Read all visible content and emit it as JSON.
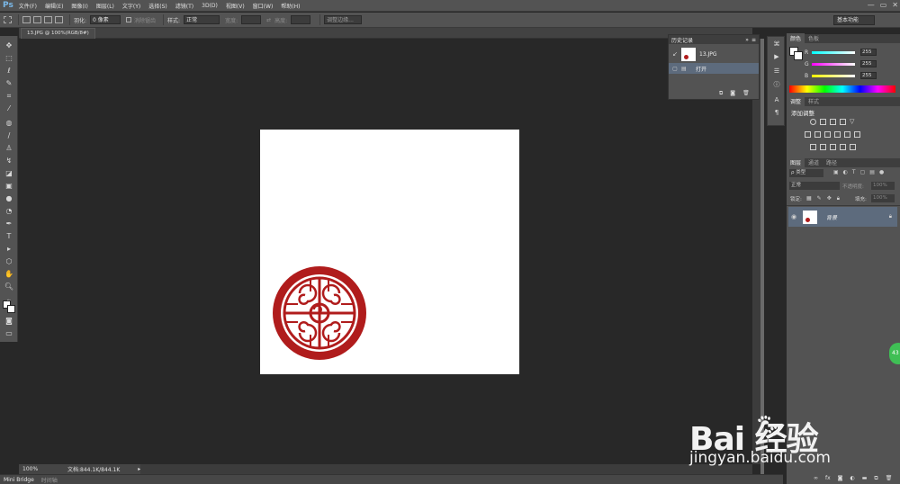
{
  "app": {
    "logo": "Ps"
  },
  "menu": [
    "文件(F)",
    "编辑(E)",
    "图像(I)",
    "图层(L)",
    "文字(Y)",
    "选择(S)",
    "滤镜(T)",
    "3D(D)",
    "视图(V)",
    "窗口(W)",
    "帮助(H)"
  ],
  "window_controls": [
    "—",
    "▭",
    "✕"
  ],
  "options": {
    "feather_label": "羽化:",
    "feather_value": "0 像素",
    "antialias": "消除锯齿",
    "style_label": "样式:",
    "style_value": "正常",
    "width_label": "宽度:",
    "height_label": "高度:",
    "refine_edge": "调整边缘...",
    "workspace": "基本功能"
  },
  "document": {
    "tab_title": "13.JPG @ 100%(RGB/8#)"
  },
  "status": {
    "zoom": "100%",
    "doc_info": "文档:844.1K/844.1K"
  },
  "mini_bridge": {
    "tab1": "Mini Bridge",
    "tab2": "时间轴"
  },
  "history": {
    "title": "历史记录",
    "snapshot": "13.JPG",
    "items": [
      "打开"
    ]
  },
  "color_panel": {
    "tabs": [
      "颜色",
      "色板"
    ],
    "channels": [
      {
        "label": "R",
        "value": "255"
      },
      {
        "label": "G",
        "value": "255"
      },
      {
        "label": "B",
        "value": "255"
      }
    ]
  },
  "adjustments": {
    "tabs": [
      "调整",
      "样式"
    ],
    "heading": "添加调整"
  },
  "layers": {
    "tabs": [
      "图层",
      "通道",
      "路径"
    ],
    "kind_label": "ρ 类型",
    "blend_mode": "正常",
    "opacity_label": "不透明度:",
    "opacity_value": "100%",
    "lock_label": "锁定:",
    "fill_label": "填充:",
    "fill_value": "100%",
    "layer_name": "背景"
  },
  "watermark": {
    "brand": "Bai  经验",
    "url": "jingyan.baidu.com"
  },
  "side_button": {
    "label": "43"
  },
  "colors": {
    "stamp_red": "#b01c1c",
    "ps_blue": "#7ab8e8",
    "layer_selected": "#5d6b7d"
  }
}
